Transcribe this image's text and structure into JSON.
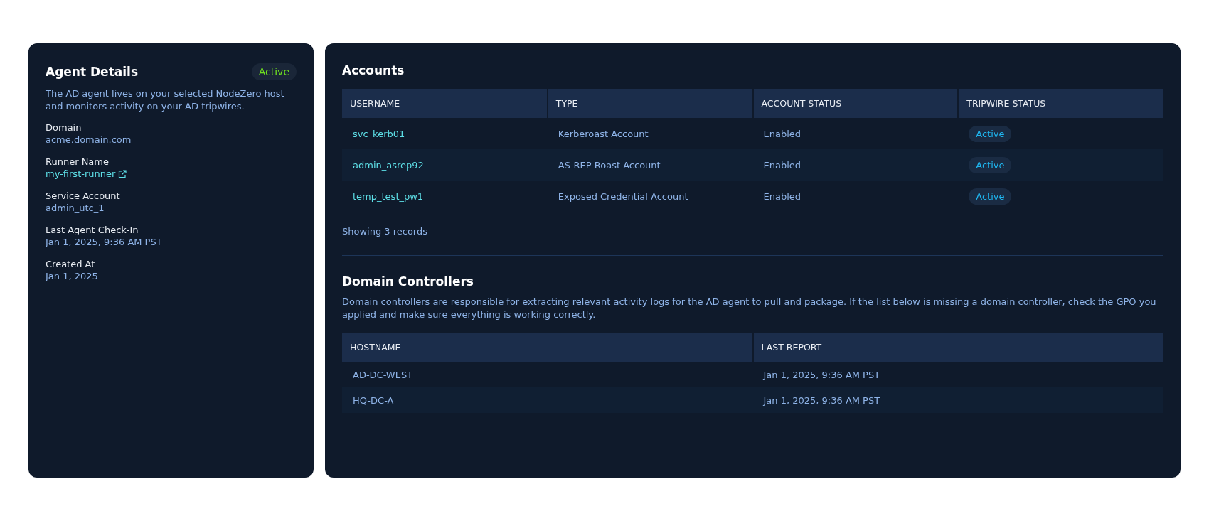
{
  "agent_details": {
    "title": "Agent Details",
    "status": "Active",
    "description": "The AD agent lives on your selected NodeZero host and monitors activity on your AD tripwires.",
    "fields": [
      {
        "label": "Domain",
        "value": "acme.domain.com",
        "kind": "text"
      },
      {
        "label": "Runner Name",
        "value": "my-first-runner",
        "kind": "link"
      },
      {
        "label": "Service Account",
        "value": "admin_utc_1",
        "kind": "text"
      },
      {
        "label": "Last Agent Check-In",
        "value": "Jan 1, 2025, 9:36 AM PST",
        "kind": "text"
      },
      {
        "label": "Created At",
        "value": "Jan 1, 2025",
        "kind": "text"
      }
    ]
  },
  "accounts": {
    "title": "Accounts",
    "columns": [
      "USERNAME",
      "TYPE",
      "ACCOUNT STATUS",
      "TRIPWIRE STATUS"
    ],
    "rows": [
      {
        "username": "svc_kerb01",
        "type": "Kerberoast Account",
        "account_status": "Enabled",
        "tripwire_status": "Active"
      },
      {
        "username": "admin_asrep92",
        "type": "AS-REP Roast Account",
        "account_status": "Enabled",
        "tripwire_status": "Active"
      },
      {
        "username": "temp_test_pw1",
        "type": "Exposed Credential Account",
        "account_status": "Enabled",
        "tripwire_status": "Active"
      }
    ],
    "footer": "Showing 3 records"
  },
  "domain_controllers": {
    "title": "Domain Controllers",
    "description": "Domain controllers are responsible for extracting relevant activity logs for the AD agent to pull and package. If the list below is missing a domain controller, check the GPO you applied and make sure everything is working correctly.",
    "columns": [
      "HOSTNAME",
      "LAST REPORT"
    ],
    "rows": [
      {
        "hostname": "AD-DC-WEST",
        "last_report": "Jan 1, 2025, 9:36 AM PST"
      },
      {
        "hostname": "HQ-DC-A",
        "last_report": "Jan 1, 2025, 9:36 AM PST"
      }
    ]
  }
}
